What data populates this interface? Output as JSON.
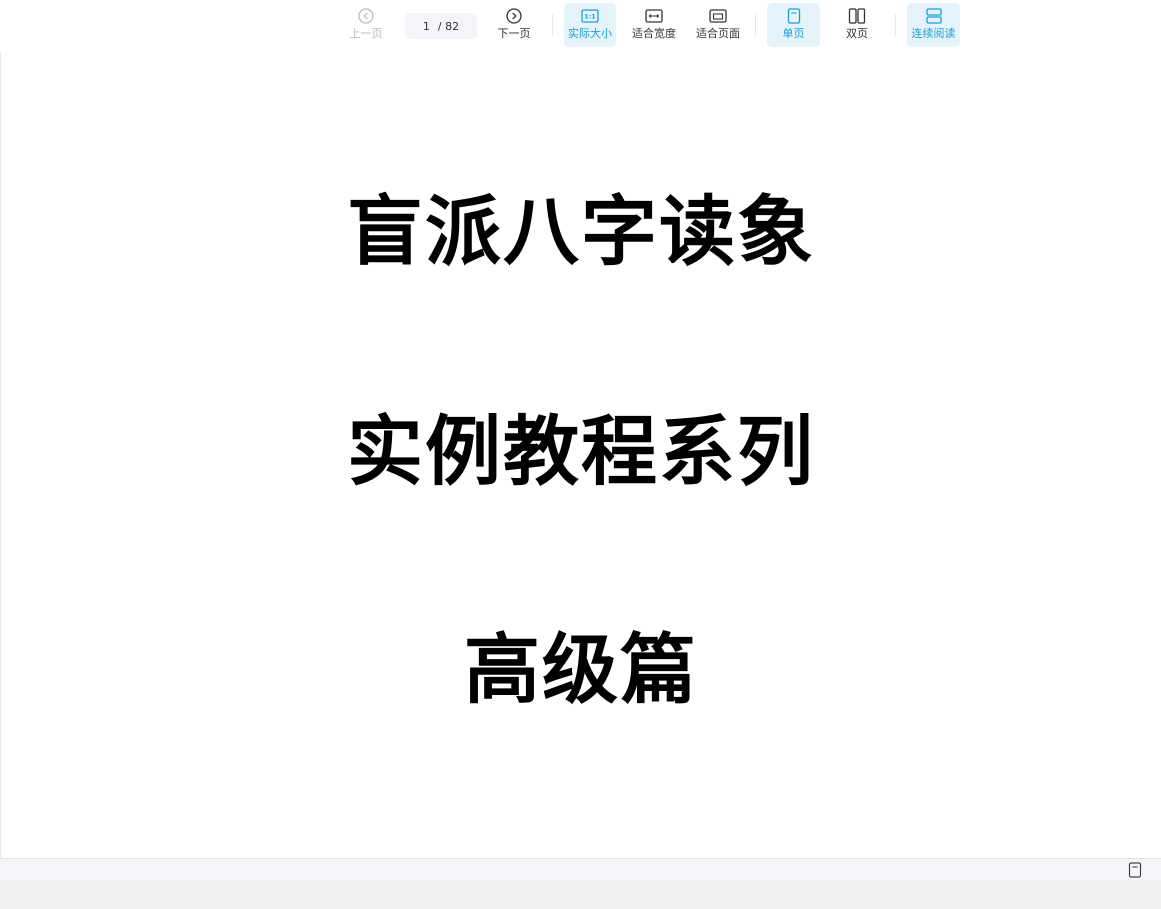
{
  "toolbar": {
    "prev_label": "上一页",
    "next_label": "下一页",
    "page_current": "1",
    "page_total": "/ 82",
    "actual_size_label": "实际大小",
    "actual_size_icon_text": "1:1",
    "fit_width_label": "适合宽度",
    "fit_page_label": "适合页面",
    "single_page_label": "单页",
    "double_page_label": "双页",
    "continuous_label": "连续阅读"
  },
  "document": {
    "lines": [
      "盲派八字读象",
      "实例教程系列",
      "高级篇"
    ]
  },
  "icons": {
    "prev": "chevron-left-circle-icon",
    "next": "chevron-right-circle-icon",
    "actual_size": "actual-size-icon",
    "fit_width": "fit-width-icon",
    "fit_page": "fit-page-icon",
    "single_page": "single-page-icon",
    "double_page": "double-page-icon",
    "continuous": "continuous-read-icon",
    "status": "page-icon"
  },
  "colors": {
    "accent": "#1a9ed6",
    "active_bg": "#e5f4fb",
    "disabled": "#b8bcc4",
    "text": "#333333"
  }
}
